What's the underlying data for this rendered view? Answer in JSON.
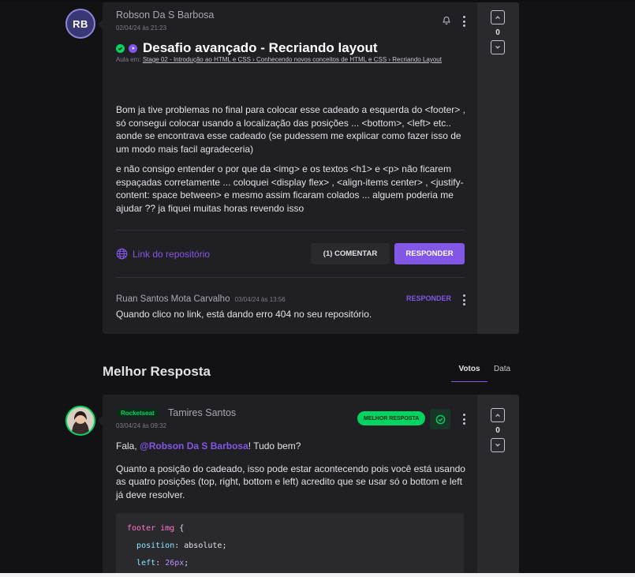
{
  "post": {
    "avatar_initials": "RB",
    "author": "Robson Da S Barbosa",
    "date": "02/04/24 às 21:23",
    "title": "Desafio avançado - Recriando layout",
    "lesson_prefix": "Aula em:",
    "lesson_path": "Stage 02 - Introdução ao HTML e CSS › Conhecendo novos conceitos de HTML e CSS › Recriando Layout",
    "body_p1": "Bom ja tive problemas no final para colocar esse cadeado a esquerda do <footer> , só consegui colocar usando a localização das posições ... <bottom>, <left> etc.. aonde se encontrava esse cadeado (se pudessem me explicar como fazer isso de um modo mais facil agradeceria)",
    "body_p2": "e não consigo entender o por que da <img> e os textos <h1> e <p> não ficarem espaçadas corretamente ... coloquei <display flex> , <align-items center> , <justify-content: space between> e mesmo assim ficaram colados ... alguem poderia me ajudar ?? ja fiquei muitas horas revendo isso",
    "repo_link": "Link do repositório",
    "comment_button": "(1) COMENTAR",
    "reply_button": "RESPONDER",
    "vote_count": "0"
  },
  "comment": {
    "author": "Ruan Santos Mota Carvalho",
    "date": "03/04/24 às 13:56",
    "reply": "RESPONDER",
    "text": "Quando clico no link, está dando erro 404 no seu repositório."
  },
  "best_answer": {
    "section_title": "Melhor Resposta",
    "tabs": [
      "Votos",
      "Data"
    ],
    "badge": "Rocketseat",
    "author": "Tamires Santos",
    "date": "03/04/24 às 09:32",
    "best_label": "MELHOR RESPOSTA",
    "greeting_pre": "Fala, ",
    "mention": "@Robson Da S Barbosa",
    "greeting_post": "! Tudo bem?",
    "body_p2": "Quanto a posição do cadeado, isso pode estar acontecendo pois você está usando as quatro posições (top, right, bottom e left) acredito que se usar só o bottom e left já deve resolver.",
    "vote_count": "0",
    "code": {
      "selector": "footer img",
      "brace": " {",
      "prop1": "position",
      "val1": "absolute",
      "prop2": "left",
      "val2": "26px"
    }
  },
  "colors": {
    "accent": "#8257e5",
    "success": "#04d361",
    "background": "#121214",
    "card": "#202024"
  }
}
